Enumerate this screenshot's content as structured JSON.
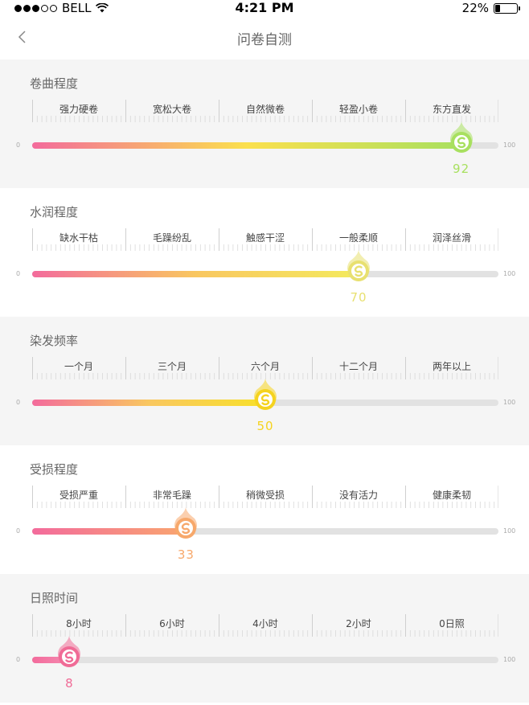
{
  "status_bar": {
    "carrier": "BELL",
    "time": "4:21 PM",
    "battery": "22%",
    "battery_level": 0.22,
    "signal_bars": 3
  },
  "nav": {
    "back_icon": "chevron-left-icon",
    "title": "问卷自测"
  },
  "scale_min": "0",
  "scale_max": "100",
  "sections": [
    {
      "title": "卷曲程度",
      "options": [
        "强力硬卷",
        "宽松大卷",
        "自然微卷",
        "轻盈小卷",
        "东方直发"
      ],
      "value": 92,
      "value_label": "92",
      "color": "#a8e05f",
      "gradient": [
        "#f36b9c",
        "#fbe04d",
        "#a8e05f"
      ]
    },
    {
      "title": "水润程度",
      "options": [
        "缺水干枯",
        "毛躁纷乱",
        "触感干涩",
        "一般柔顺",
        "润泽丝滑"
      ],
      "value": 70,
      "value_label": "70",
      "color": "#e8e070",
      "gradient": [
        "#f36b9c",
        "#f9c760",
        "#f4ea5e"
      ]
    },
    {
      "title": "染发频率",
      "options": [
        "一个月",
        "三个月",
        "六个月",
        "十二个月",
        "两年以上"
      ],
      "value": 50,
      "value_label": "50",
      "color": "#f5d31f",
      "gradient": [
        "#f36b9c",
        "#f9c760",
        "#f8e02a"
      ]
    },
    {
      "title": "受损程度",
      "options": [
        "受损严重",
        "非常毛躁",
        "稍微受损",
        "没有活力",
        "健康柔韧"
      ],
      "value": 33,
      "value_label": "33",
      "color": "#f7a86b",
      "gradient": [
        "#f36b9c",
        "#f9a56f"
      ]
    },
    {
      "title": "日照时间",
      "options": [
        "8小时",
        "6小时",
        "4小时",
        "2小时",
        "0日照"
      ],
      "value": 8,
      "value_label": "8",
      "color": "#f06b96",
      "gradient": [
        "#f36b9c",
        "#f58ab0"
      ]
    }
  ]
}
